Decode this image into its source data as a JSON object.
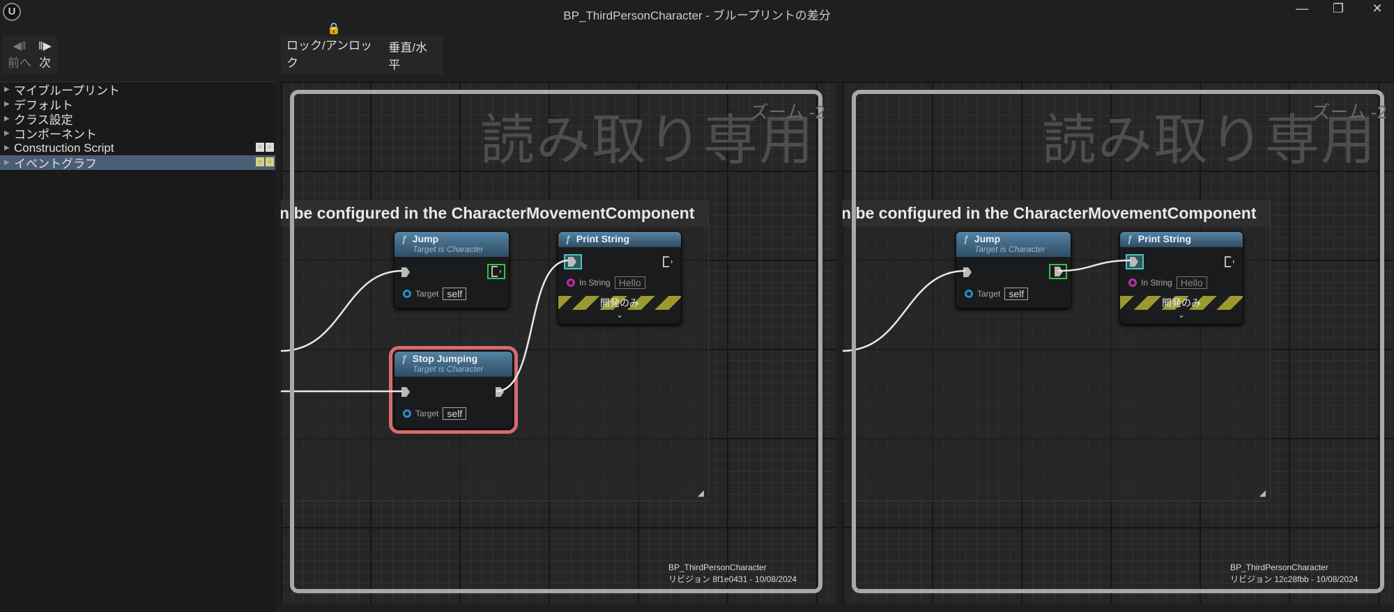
{
  "window": {
    "title": "BP_ThirdPersonCharacter - ブループリントの差分",
    "logo": "U",
    "minimize": "—",
    "restore": "❐",
    "close": "✕"
  },
  "toolbar": {
    "prev_label": "前へ",
    "next_label": "次",
    "prev_icon": "◀‖",
    "next_icon": "‖▶",
    "lock_label": "ロック/アンロック",
    "lock_icon": "🔒",
    "orient_label": "垂直/水平"
  },
  "sidebar": {
    "items": [
      {
        "label": "マイブループリント",
        "selected": false,
        "graph_icons": false
      },
      {
        "label": "デフォルト",
        "selected": false,
        "graph_icons": false
      },
      {
        "label": "クラス設定",
        "selected": false,
        "graph_icons": false
      },
      {
        "label": "コンポーネント",
        "selected": false,
        "graph_icons": false
      },
      {
        "label": "Construction Script",
        "selected": false,
        "graph_icons": true
      },
      {
        "label": "イベントグラフ",
        "selected": true,
        "graph_icons": true
      }
    ]
  },
  "panels": [
    {
      "watermark": "読み取り専用",
      "zoom": "ズーム -2",
      "comment": "n be configured in the CharacterMovementComponent",
      "jump": {
        "title": "Jump",
        "subtitle": "Target is Character",
        "target_label": "Target",
        "target_value": "self"
      },
      "stop": {
        "title": "Stop Jumping",
        "subtitle": "Target is Character",
        "target_label": "Target",
        "target_value": "self"
      },
      "print": {
        "title": "Print String",
        "in_label": "In String",
        "in_value": "Hello",
        "dev_label": "開発のみ"
      },
      "footer": {
        "name": "BP_ThirdPersonCharacter",
        "revision": "リビジョン 8f1e0431 - 10/08/2024"
      }
    },
    {
      "watermark": "読み取り専用",
      "zoom": "ズーム -2",
      "comment": "n be configured in the CharacterMovementComponent",
      "jump": {
        "title": "Jump",
        "subtitle": "Target is Character",
        "target_label": "Target",
        "target_value": "self"
      },
      "print": {
        "title": "Print String",
        "in_label": "In String",
        "in_value": "Hello",
        "dev_label": "開発のみ"
      },
      "footer": {
        "name": "BP_ThirdPersonCharacter",
        "revision": "リビジョン 12c28fbb - 10/08/2024"
      }
    }
  ],
  "colors": {
    "selection_outline": "#d86a6e",
    "node_header": "#4a7799",
    "selected_row": "#4a5f75"
  }
}
